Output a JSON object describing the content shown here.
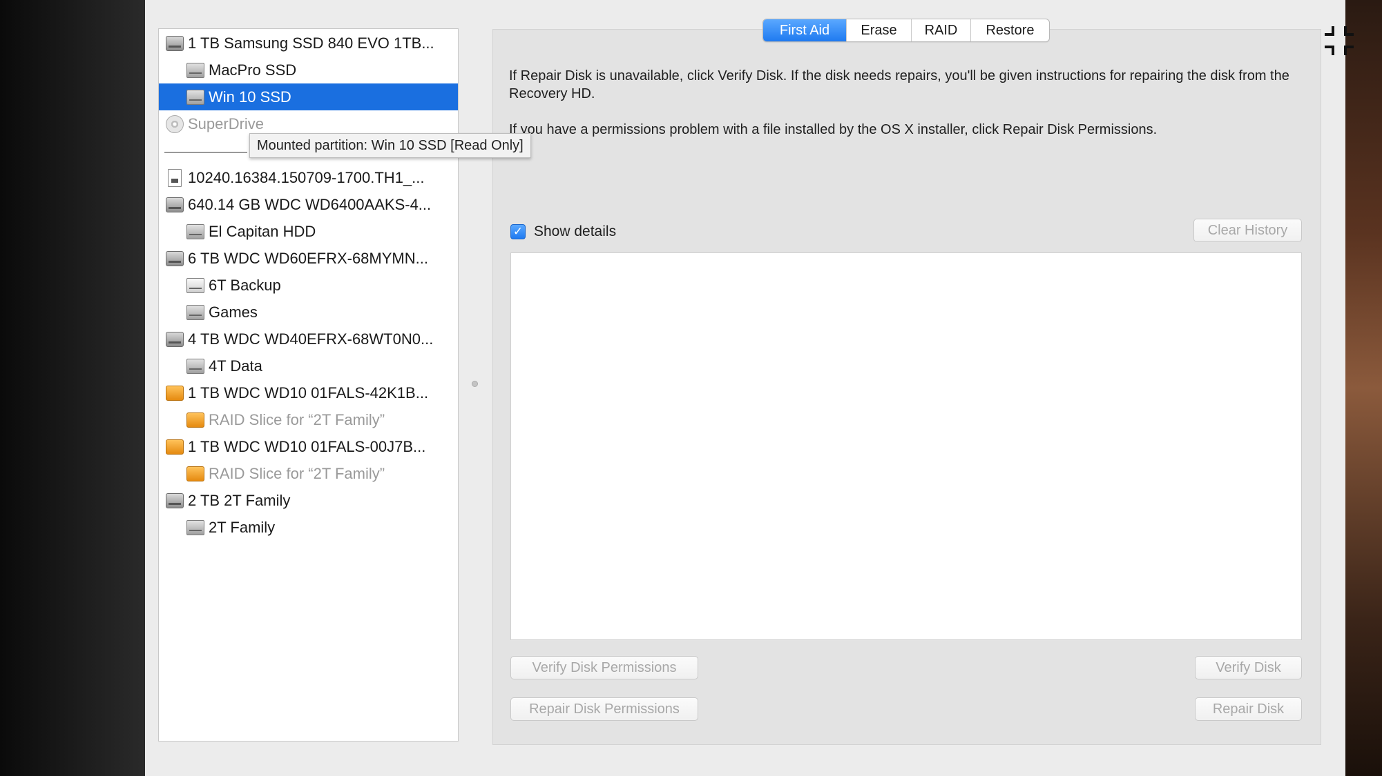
{
  "sidebar": {
    "items": [
      {
        "label": "1 TB Samsung SSD 840 EVO 1TB...",
        "icon": "drive-icon",
        "level": 0,
        "state": "normal"
      },
      {
        "label": "MacPro SSD",
        "icon": "volume-icon",
        "level": 1,
        "state": "normal"
      },
      {
        "label": "Win 10 SSD",
        "icon": "volume-icon",
        "level": 1,
        "state": "selected"
      },
      {
        "label": "SuperDrive",
        "icon": "optical-drive-icon",
        "level": 0,
        "state": "dim"
      },
      {
        "label": "10240.16384.150709-1700.TH1_...",
        "icon": "disk-image-icon",
        "level": 0,
        "state": "normal"
      },
      {
        "label": "640.14 GB WDC WD6400AAKS-4...",
        "icon": "drive-icon",
        "level": 0,
        "state": "normal"
      },
      {
        "label": "El Capitan HDD",
        "icon": "volume-icon",
        "level": 1,
        "state": "normal"
      },
      {
        "label": "6 TB WDC WD60EFRX-68MYMN...",
        "icon": "drive-icon",
        "level": 0,
        "state": "normal"
      },
      {
        "label": "6T Backup",
        "icon": "volume-white-icon",
        "level": 1,
        "state": "normal"
      },
      {
        "label": "Games",
        "icon": "volume-icon",
        "level": 1,
        "state": "normal"
      },
      {
        "label": "4 TB WDC WD40EFRX-68WT0N0...",
        "icon": "drive-icon",
        "level": 0,
        "state": "normal"
      },
      {
        "label": "4T Data",
        "icon": "volume-icon",
        "level": 1,
        "state": "normal"
      },
      {
        "label": "1 TB WDC WD10 01FALS-42K1B...",
        "icon": "raid-drive-icon",
        "level": 0,
        "state": "normal"
      },
      {
        "label": "RAID Slice for “2T Family”",
        "icon": "raid-slice-icon",
        "level": 1,
        "state": "dim"
      },
      {
        "label": "1 TB WDC WD10 01FALS-00J7B...",
        "icon": "raid-drive-icon",
        "level": 0,
        "state": "normal"
      },
      {
        "label": "RAID Slice for “2T Family”",
        "icon": "raid-slice-icon",
        "level": 1,
        "state": "dim"
      },
      {
        "label": "2 TB 2T Family",
        "icon": "drive-icon",
        "level": 0,
        "state": "normal"
      },
      {
        "label": "2T Family",
        "icon": "volume-icon",
        "level": 1,
        "state": "normal"
      }
    ],
    "tooltip": "Mounted partition: Win 10 SSD [Read Only]"
  },
  "tabs": [
    "First Aid",
    "Erase",
    "RAID",
    "Restore"
  ],
  "active_tab": "First Aid",
  "info": {
    "line1": "If Repair Disk is unavailable, click Verify Disk. If the disk needs repairs, you'll be given instructions for repairing the disk from the Recovery HD.",
    "line2": "If you have a permissions problem with a file installed by the OS X installer, click Repair Disk Permissions."
  },
  "show_details": {
    "label": "Show details",
    "checked": true
  },
  "buttons": {
    "clear_history": "Clear History",
    "verify_permissions": "Verify Disk Permissions",
    "repair_permissions": "Repair Disk Permissions",
    "verify_disk": "Verify Disk",
    "repair_disk": "Repair Disk"
  },
  "colors": {
    "selection": "#1a6fe0",
    "active_tab": "#2a83f5",
    "window_bg": "#ececec"
  }
}
